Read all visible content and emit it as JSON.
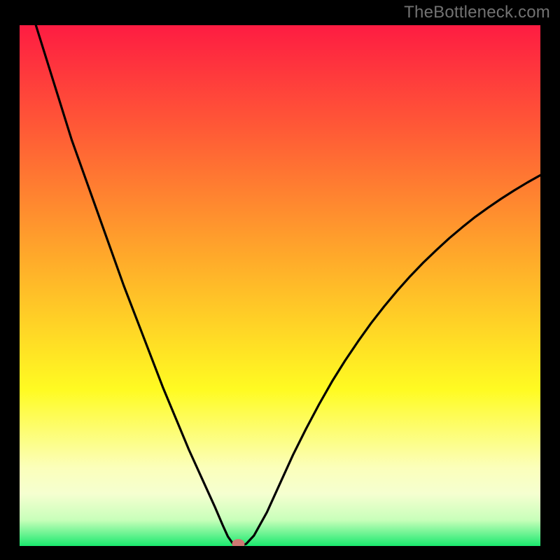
{
  "watermark": "TheBottleneck.com",
  "colors": {
    "frame": "#000000",
    "gradient_top": "#fe1c42",
    "gradient_mid1": "#ff8a2f",
    "gradient_mid2": "#fffb22",
    "gradient_low": "#fbffbb",
    "gradient_bottom": "#1ae96e",
    "curve": "#000000",
    "marker": "#cf7a73"
  },
  "chart_data": {
    "type": "line",
    "title": "",
    "xlabel": "",
    "ylabel": "",
    "xlim": [
      0,
      100
    ],
    "ylim": [
      0,
      100
    ],
    "series": [
      {
        "name": "bottleneck-curve",
        "x": [
          0,
          2.5,
          5,
          7.5,
          10,
          12.5,
          15,
          17.5,
          20,
          22.5,
          25,
          27.5,
          30,
          32.5,
          35,
          37.5,
          39,
          40,
          41,
          42,
          43.5,
          45,
          47.5,
          50,
          52.5,
          55,
          57.5,
          60,
          62.5,
          65,
          67.5,
          70,
          72.5,
          75,
          77.5,
          80,
          82.5,
          85,
          87.5,
          90,
          92.5,
          95,
          97.5,
          100
        ],
        "y": [
          110,
          102,
          94,
          86,
          78,
          71,
          64,
          57,
          50,
          43.5,
          37,
          30.5,
          24.5,
          18.5,
          13,
          7.5,
          4,
          1.8,
          0.4,
          0,
          0.4,
          2,
          6.5,
          12,
          17.5,
          22.5,
          27.2,
          31.6,
          35.6,
          39.3,
          42.8,
          46,
          49,
          51.8,
          54.4,
          56.8,
          59.1,
          61.2,
          63.2,
          65,
          66.7,
          68.3,
          69.8,
          71.2
        ]
      }
    ],
    "marker": {
      "x": 42,
      "y": 0
    },
    "gradient_stops": [
      {
        "offset": 0.0,
        "color": "#fe1c42"
      },
      {
        "offset": 0.2,
        "color": "#ff5a36"
      },
      {
        "offset": 0.45,
        "color": "#ffab2a"
      },
      {
        "offset": 0.7,
        "color": "#fffb22"
      },
      {
        "offset": 0.85,
        "color": "#fbffbb"
      },
      {
        "offset": 0.9,
        "color": "#f5ffd0"
      },
      {
        "offset": 0.95,
        "color": "#c8ffba"
      },
      {
        "offset": 1.0,
        "color": "#1ae96e"
      }
    ]
  }
}
